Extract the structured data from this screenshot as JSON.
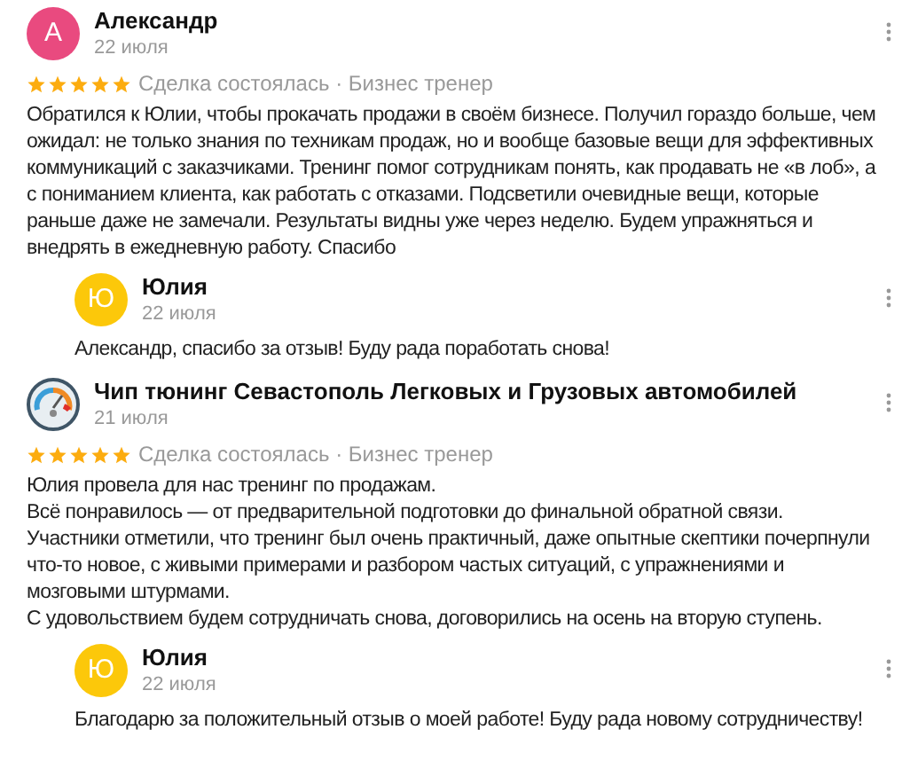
{
  "reviews": [
    {
      "author": "Александр",
      "date": "22 июля",
      "avatar": {
        "kind": "letter",
        "letter": "А",
        "color": "#e94a7f"
      },
      "stars": 5,
      "meta": "Сделка состоялась · Бизнес тренер",
      "text": "Обратился к Юлии, чтобы прокачать продажи в своём бизнесе. Получил гораздо больше, чем ожидал: не только знания по техникам продаж, но и вообще базовые вещи для эффективных коммуникаций с заказчиками. Тренинг помог сотрудникам понять, как продавать не «в лоб», а с пониманием клиента, как работать с отказами. Подсветили очевидные вещи, которые раньше даже не замечали. Результаты видны уже через неделю. Будем упражняться и внедрять в ежедневную работу. Спасибо",
      "reply": {
        "author": "Юлия",
        "date": "22 июля",
        "avatar": {
          "kind": "letter",
          "letter": "Ю",
          "color": "#fcc80a"
        },
        "text": "Александр, спасибо за отзыв! Буду рада поработать снова!"
      }
    },
    {
      "author": "Чип тюнинг Севастополь Легковых и Грузовых автомобилей",
      "date": "21 июля",
      "avatar": {
        "kind": "logo"
      },
      "stars": 5,
      "meta": "Сделка состоялась · Бизнес тренер",
      "text": "Юлия провела для нас тренинг по продажам.\nВсё понравилось — от предварительной подготовки до финальной обратной связи.\nУчастники отметили, что тренинг был очень практичный, даже опытные скептики почерпнули что-то новое, с живыми примерами и разбором частых ситуаций, с упражнениями и мозговыми штурмами.\nС удовольствием будем сотрудничать снова, договорились на осень на вторую ступень.",
      "reply": {
        "author": "Юлия",
        "date": "22 июля",
        "avatar": {
          "kind": "letter",
          "letter": "Ю",
          "color": "#fcc80a"
        },
        "text": "Благодарю за положительный отзыв о моей работе! Буду рада новому сотрудничеству!"
      }
    }
  ]
}
